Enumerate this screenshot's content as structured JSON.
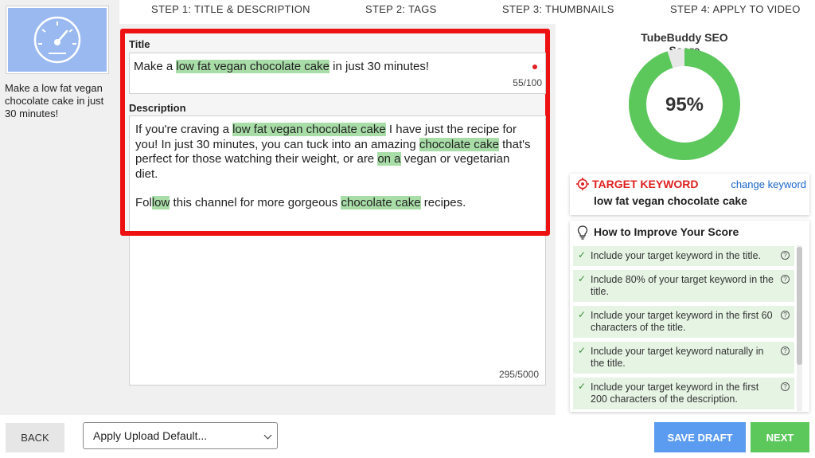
{
  "sidebar": {
    "thumbnail_icon": "speedometer-icon",
    "video_title": "Make a low fat vegan chocolate cake in just 30 minutes!"
  },
  "steps": [
    {
      "label": "STEP 1:",
      "name": "TITLE & DESCRIPTION",
      "active": true
    },
    {
      "label": "STEP 2:",
      "name": "TAGS",
      "active": false
    },
    {
      "label": "STEP 3:",
      "name": "THUMBNAILS",
      "active": false
    },
    {
      "label": "STEP 4:",
      "name": "APPLY TO VIDEO",
      "active": false
    }
  ],
  "editor": {
    "title_label": "Title",
    "title_before": "Make a ",
    "title_keyword": "low fat vegan chocolate cake",
    "title_after": " in just 30 minutes!",
    "title_count": "55/100",
    "description_label": "Description",
    "description_p1": {
      "t1": "If you're craving a ",
      "k1": "low fat vegan chocolate cake",
      "t2": " I have just the recipe for you! In just 30 minutes, you can tuck into an amazing ",
      "k2": " chocolate cake",
      "t3": " that's perfect for those watching their weight, or are ",
      "k3": "on a",
      "t4": " vegan or vegetarian diet."
    },
    "description_p2": {
      "t1": "Fol",
      "k1": "low",
      "t2": " this channel for more gorgeous ",
      "k2": " chocolate cake",
      "t3": " recipes."
    },
    "description_count": "295/5000"
  },
  "seo": {
    "title": "TubeBuddy SEO Score",
    "score": 95,
    "score_label": "95%",
    "colors": {
      "good": "#5cc85c",
      "remaining": "#e8e8e8"
    }
  },
  "keyword": {
    "label": "TARGET KEYWORD",
    "change_label": "change keyword",
    "value": "low fat vegan chocolate cake",
    "icon": "target-icon"
  },
  "improve": {
    "title": "How to Improve Your Score",
    "icon": "lightbulb-icon",
    "tips": [
      "Include your target keyword in the title.",
      "Include 80% of your target keyword in the title.",
      "Include your target keyword in the first 60 characters of the title.",
      "Include your target keyword naturally in the title.",
      "Include your target keyword in the first 200 characters of the description."
    ]
  },
  "footer": {
    "back_label": "BACK",
    "select_value": "Apply Upload Default...",
    "save_label": "SAVE DRAFT",
    "next_label": "NEXT"
  }
}
